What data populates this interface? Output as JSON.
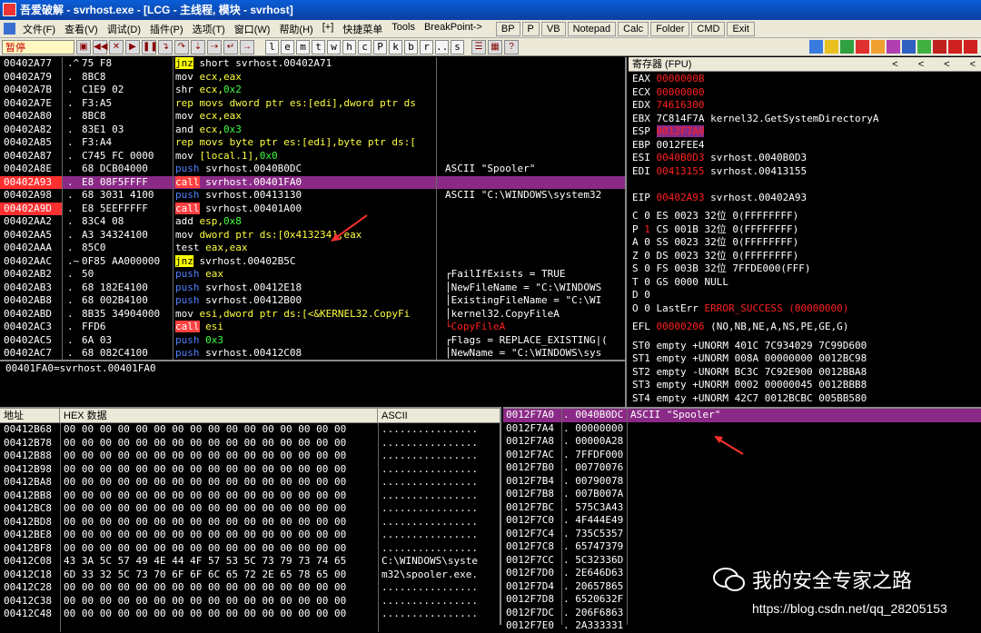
{
  "title": "吾爱破解 - svrhost.exe - [LCG -  主线程, 模块 - svrhost]",
  "menu": [
    "文件(F)",
    "查看(V)",
    "调试(D)",
    "插件(P)",
    "选项(T)",
    "窗口(W)",
    "帮助(H)",
    "[+]",
    "快捷菜单",
    "Tools",
    "BreakPoint->"
  ],
  "menu_buttons": [
    "BP",
    "P",
    "VB",
    "Notepad",
    "Calc",
    "Folder",
    "CMD",
    "Exit"
  ],
  "toolbar": {
    "status": "暂停",
    "letters": [
      "l",
      "e",
      "m",
      "t",
      "w",
      "h",
      "c",
      "P",
      "k",
      "b",
      "r",
      "...",
      "s"
    ]
  },
  "disasm": [
    {
      "addr": "00402A77",
      "m": ".^",
      "hex": "75 F8",
      "ins": [
        [
          "jnz",
          "j"
        ],
        [
          " short svrhost.00402A71",
          ""
        ]
      ],
      "cmt": ""
    },
    {
      "addr": "00402A79",
      "m": ".",
      "hex": "8BC8",
      "ins": [
        [
          "mov ",
          ""
        ],
        [
          "ecx,eax",
          "y"
        ]
      ],
      "cmt": ""
    },
    {
      "addr": "00402A7B",
      "m": ".",
      "hex": "C1E9 02",
      "ins": [
        [
          "shr ",
          ""
        ],
        [
          "ecx,",
          "y"
        ],
        [
          "0x2",
          "g"
        ]
      ],
      "cmt": ""
    },
    {
      "addr": "00402A7E",
      "m": ".",
      "hex": "F3:A5",
      "ins": [
        [
          "rep movs dword ptr es:[edi],dword ptr ds",
          "y"
        ]
      ],
      "cmt": ""
    },
    {
      "addr": "00402A80",
      "m": ".",
      "hex": "8BC8",
      "ins": [
        [
          "mov ",
          ""
        ],
        [
          "ecx,eax",
          "y"
        ]
      ],
      "cmt": ""
    },
    {
      "addr": "00402A82",
      "m": ".",
      "hex": "83E1 03",
      "ins": [
        [
          "and ",
          ""
        ],
        [
          "ecx,",
          "y"
        ],
        [
          "0x3",
          "g"
        ]
      ],
      "cmt": ""
    },
    {
      "addr": "00402A85",
      "m": ".",
      "hex": "F3:A4",
      "ins": [
        [
          "rep movs byte ptr es:[edi],byte ptr ds:[",
          "y"
        ]
      ],
      "cmt": ""
    },
    {
      "addr": "00402A87",
      "m": ".",
      "hex": "C745 FC 0000",
      "ins": [
        [
          "mov ",
          ""
        ],
        [
          "[local.1],",
          "y"
        ],
        [
          "0x0",
          "g"
        ]
      ],
      "cmt": ""
    },
    {
      "addr": "00402A8E",
      "m": ".",
      "hex": "68 DCB04000",
      "ins": [
        [
          "push",
          "p"
        ],
        [
          " svrhost.0040B0DC",
          ""
        ]
      ],
      "cmt": "ASCII \"Spooler\""
    },
    {
      "addr": "00402A93",
      "m": ".",
      "hex": "E8 08F5FFFF",
      "ins": [
        [
          "call",
          "c"
        ],
        [
          " svrhost.00401FA0",
          ""
        ]
      ],
      "cmt": "",
      "sel": true,
      "addrRed": true
    },
    {
      "addr": "00402A98",
      "m": ".",
      "hex": "68 3031 4100",
      "ins": [
        [
          "push",
          "p"
        ],
        [
          " svrhost.00413130",
          ""
        ]
      ],
      "cmt": "ASCII \"C:\\WINDOWS\\system32"
    },
    {
      "addr": "00402A9D",
      "m": ".",
      "hex": "E8 5EEFFFFF",
      "ins": [
        [
          "call",
          "c"
        ],
        [
          " svrhost.00401A00",
          ""
        ]
      ],
      "cmt": "",
      "addrRed": true
    },
    {
      "addr": "00402AA2",
      "m": ".",
      "hex": "83C4 08",
      "ins": [
        [
          "add ",
          ""
        ],
        [
          "esp,",
          "y"
        ],
        [
          "0x8",
          "g"
        ]
      ],
      "cmt": ""
    },
    {
      "addr": "00402AA5",
      "m": ".",
      "hex": "A3 34324100",
      "ins": [
        [
          "mov ",
          ""
        ],
        [
          "dword ptr ds:[0x413234],eax",
          "y"
        ]
      ],
      "cmt": ""
    },
    {
      "addr": "00402AAA",
      "m": ".",
      "hex": "85C0",
      "ins": [
        [
          "test ",
          ""
        ],
        [
          "eax,eax",
          "y"
        ]
      ],
      "cmt": ""
    },
    {
      "addr": "00402AAC",
      "m": ".~",
      "hex": "0F85 AA000000",
      "ins": [
        [
          "jnz",
          "j"
        ],
        [
          " svrhost.00402B5C",
          ""
        ]
      ],
      "cmt": ""
    },
    {
      "addr": "00402AB2",
      "m": ".",
      "hex": "50",
      "ins": [
        [
          "push",
          "p"
        ],
        [
          " eax",
          "y"
        ]
      ],
      "cmt": "┌FailIfExists = TRUE"
    },
    {
      "addr": "00402AB3",
      "m": ".",
      "hex": "68 182E4100",
      "ins": [
        [
          "push",
          "p"
        ],
        [
          " svrhost.00412E18",
          ""
        ]
      ],
      "cmt": "│NewFileName = \"C:\\WINDOWS"
    },
    {
      "addr": "00402AB8",
      "m": ".",
      "hex": "68 002B4100",
      "ins": [
        [
          "push",
          "p"
        ],
        [
          " svrhost.00412B00",
          ""
        ]
      ],
      "cmt": "│ExistingFileName = \"C:\\WI"
    },
    {
      "addr": "00402ABD",
      "m": ".",
      "hex": "8B35 34904000",
      "ins": [
        [
          "mov ",
          ""
        ],
        [
          "esi,dword ptr ds:[<&KERNEL32.CopyFi",
          "y"
        ]
      ],
      "cmt": "│kernel32.CopyFileA"
    },
    {
      "addr": "00402AC3",
      "m": ".",
      "hex": "FFD6",
      "ins": [
        [
          "call",
          "c"
        ],
        [
          " esi",
          "y"
        ]
      ],
      "cmt": "└CopyFileA",
      "cmtRed": true
    },
    {
      "addr": "00402AC5",
      "m": ".",
      "hex": "6A 03",
      "ins": [
        [
          "push",
          "p"
        ],
        [
          " 0x3",
          "g"
        ]
      ],
      "cmt": "┌Flags = REPLACE_EXISTING|("
    },
    {
      "addr": "00402AC7",
      "m": ".",
      "hex": "68 082C4100",
      "ins": [
        [
          "push",
          "p"
        ],
        [
          " svrhost.00412C08",
          ""
        ]
      ],
      "cmt": "│NewName = \"C:\\WINDOWS\\sys"
    }
  ],
  "info_line": "00401FA0=svrhost.00401FA0",
  "registers": {
    "header": "寄存器 (FPU)",
    "nav": [
      "<",
      "<",
      "<",
      "<"
    ],
    "regs": [
      {
        "n": "EAX",
        "v": "0000000B",
        "red": true,
        "d": ""
      },
      {
        "n": "ECX",
        "v": "00000000",
        "red": true,
        "d": ""
      },
      {
        "n": "EDX",
        "v": "74616300",
        "red": true,
        "d": ""
      },
      {
        "n": "EBX",
        "v": "7C814F7A",
        "red": false,
        "d": "kernel32.GetSystemDirectoryA"
      },
      {
        "n": "ESP",
        "v": "0012F7A0",
        "red": true,
        "d": "",
        "hl": true
      },
      {
        "n": "EBP",
        "v": "0012FEE4",
        "red": false,
        "d": ""
      },
      {
        "n": "ESI",
        "v": "0040B0D3",
        "red": true,
        "d": "svrhost.0040B0D3"
      },
      {
        "n": "EDI",
        "v": "00413155",
        "red": true,
        "d": "svrhost.00413155"
      },
      {
        "n": "",
        "v": "",
        "d": ""
      },
      {
        "n": "EIP",
        "v": "00402A93",
        "red": true,
        "d": "svrhost.00402A93"
      }
    ],
    "flags": [
      {
        "f": "C",
        "v": "0",
        "seg": "ES 0023 32位 0(FFFFFFFF)",
        "red": false
      },
      {
        "f": "P",
        "v": "1",
        "seg": "CS 001B 32位 0(FFFFFFFF)",
        "red": true
      },
      {
        "f": "A",
        "v": "0",
        "seg": "SS 0023 32位 0(FFFFFFFF)",
        "red": false
      },
      {
        "f": "Z",
        "v": "0",
        "seg": "DS 0023 32位 0(FFFFFFFF)",
        "red": false
      },
      {
        "f": "S",
        "v": "0",
        "seg": "FS 003B 32位 7FFDE000(FFF)",
        "red": false
      },
      {
        "f": "T",
        "v": "0",
        "seg": "GS 0000 NULL",
        "red": false
      },
      {
        "f": "D",
        "v": "0",
        "seg": "",
        "red": false
      },
      {
        "f": "O",
        "v": "0",
        "seg": "LastErr ERROR_SUCCESS (00000000)",
        "red": false,
        "segRed": true
      }
    ],
    "efl": {
      "label": "EFL",
      "v": "00000206",
      "d": "(NO,NB,NE,A,NS,PE,GE,G)"
    },
    "fpu": [
      "ST0 empty +UNORM 401C 7C934029 7C99D600",
      "ST1 empty +UNORM 008A 00000000 0012BC98",
      "ST2 empty -UNORM BC3C 7C92E900 0012BBA8",
      "ST3 empty +UNORM 0002 00000045 0012BBB8",
      "ST4 empty +UNORM 42C7 0012BCBC 005BB580"
    ]
  },
  "dump": {
    "headers": {
      "addr": "地址",
      "hex": "HEX 数据",
      "ascii": "ASCII"
    },
    "rows": [
      {
        "a": "00412B68",
        "h": "00 00 00 00 00 00 00 00 00 00 00 00 00 00 00 00",
        "s": "................"
      },
      {
        "a": "00412B78",
        "h": "00 00 00 00 00 00 00 00 00 00 00 00 00 00 00 00",
        "s": "................"
      },
      {
        "a": "00412B88",
        "h": "00 00 00 00 00 00 00 00 00 00 00 00 00 00 00 00",
        "s": "................"
      },
      {
        "a": "00412B98",
        "h": "00 00 00 00 00 00 00 00 00 00 00 00 00 00 00 00",
        "s": "................"
      },
      {
        "a": "00412BA8",
        "h": "00 00 00 00 00 00 00 00 00 00 00 00 00 00 00 00",
        "s": "................"
      },
      {
        "a": "00412BB8",
        "h": "00 00 00 00 00 00 00 00 00 00 00 00 00 00 00 00",
        "s": "................"
      },
      {
        "a": "00412BC8",
        "h": "00 00 00 00 00 00 00 00 00 00 00 00 00 00 00 00",
        "s": "................"
      },
      {
        "a": "00412BD8",
        "h": "00 00 00 00 00 00 00 00 00 00 00 00 00 00 00 00",
        "s": "................"
      },
      {
        "a": "00412BE8",
        "h": "00 00 00 00 00 00 00 00 00 00 00 00 00 00 00 00",
        "s": "................"
      },
      {
        "a": "00412BF8",
        "h": "00 00 00 00 00 00 00 00 00 00 00 00 00 00 00 00",
        "s": "................"
      },
      {
        "a": "00412C08",
        "h": "43 3A 5C 57 49 4E 44 4F 57 53 5C 73 79 73 74 65",
        "s": "C:\\WINDOWS\\syste"
      },
      {
        "a": "00412C18",
        "h": "6D 33 32 5C 73 70 6F 6F 6C 65 72 2E 65 78 65 00",
        "s": "m32\\spooler.exe."
      },
      {
        "a": "00412C28",
        "h": "00 00 00 00 00 00 00 00 00 00 00 00 00 00 00 00",
        "s": "................"
      },
      {
        "a": "00412C38",
        "h": "00 00 00 00 00 00 00 00 00 00 00 00 00 00 00 00",
        "s": "................"
      },
      {
        "a": "00412C48",
        "h": "00 00 00 00 00 00 00 00 00 00 00 00 00 00 00 00",
        "s": "................"
      }
    ]
  },
  "stack": {
    "rows": [
      {
        "a": "0012F7A0",
        "v": "0040B0DC",
        "c": "ASCII \"Spooler\"",
        "top": true
      },
      {
        "a": "0012F7A4",
        "v": "00000000",
        "c": ""
      },
      {
        "a": "0012F7A8",
        "v": "00000A28",
        "c": ""
      },
      {
        "a": "0012F7AC",
        "v": "7FFDF000",
        "c": ""
      },
      {
        "a": "0012F7B0",
        "v": "00770076",
        "c": ""
      },
      {
        "a": "0012F7B4",
        "v": "00790078",
        "c": ""
      },
      {
        "a": "0012F7B8",
        "v": "007B007A",
        "c": ""
      },
      {
        "a": "0012F7BC",
        "v": "575C3A43",
        "c": ""
      },
      {
        "a": "0012F7C0",
        "v": "4F444E49",
        "c": ""
      },
      {
        "a": "0012F7C4",
        "v": "735C5357",
        "c": ""
      },
      {
        "a": "0012F7C8",
        "v": "65747379",
        "c": ""
      },
      {
        "a": "0012F7CC",
        "v": "5C32336D",
        "c": ""
      },
      {
        "a": "0012F7D0",
        "v": "2E646D63",
        "c": ""
      },
      {
        "a": "0012F7D4",
        "v": "20657865",
        "c": ""
      },
      {
        "a": "0012F7D8",
        "v": "6520632F",
        "c": ""
      },
      {
        "a": "0012F7DC",
        "v": "206F6863",
        "c": ""
      },
      {
        "a": "0012F7E0",
        "v": "2A333331",
        "c": ""
      }
    ]
  },
  "watermark": {
    "name": "我的安全专家之路",
    "url": "https://blog.csdn.net/qq_28205153"
  },
  "colors": {
    "selection": "#8a2a86",
    "red": "#ff2020",
    "yellow": "#ffff40"
  }
}
